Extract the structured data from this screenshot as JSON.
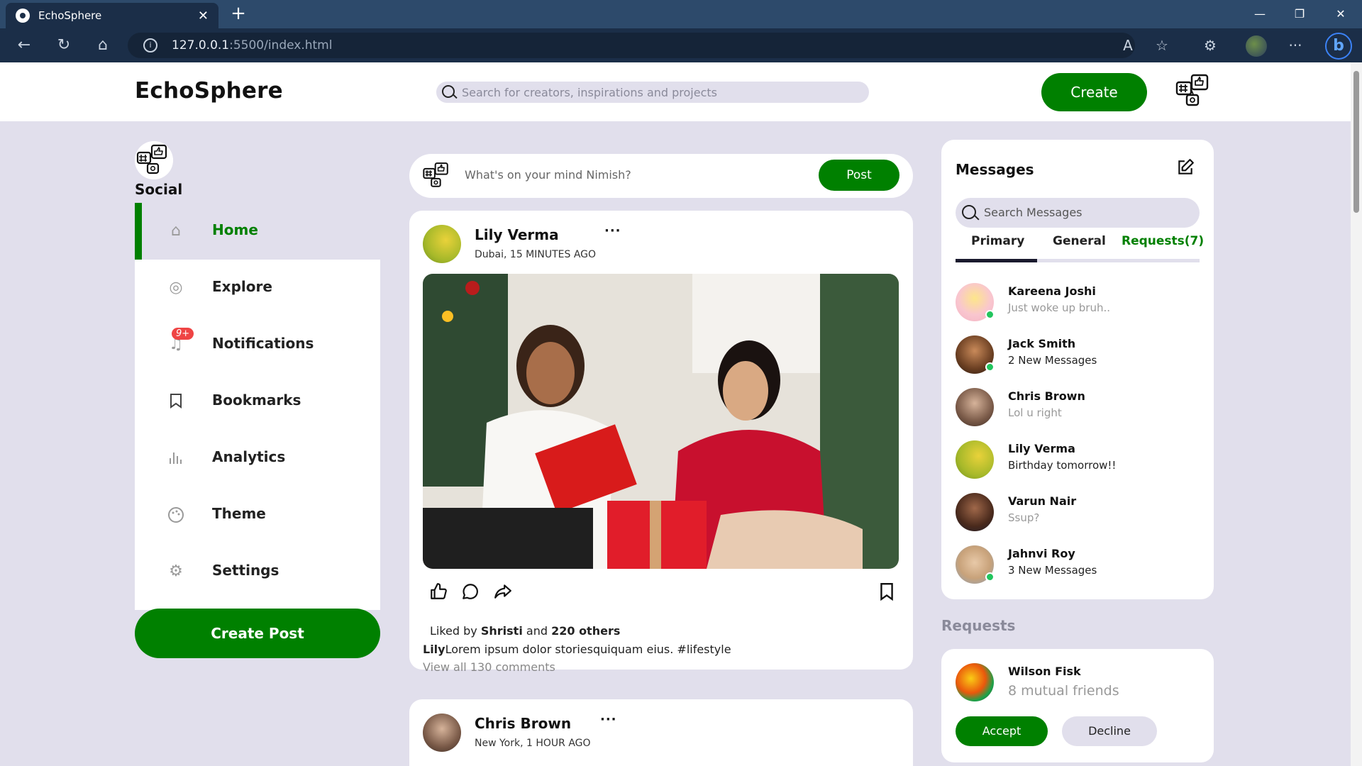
{
  "browser": {
    "tab_title": "EchoSphere",
    "url_host": "127.0.0.1",
    "url_rest": ":5500/index.html"
  },
  "app": {
    "logo": "EchoSphere",
    "search_placeholder": "Search for creators, inspirations and projects",
    "create_label": "Create",
    "accent": "#008000",
    "background": "#e1dfec"
  },
  "sidebar": {
    "profile_label": "Social",
    "items": [
      {
        "label": "Home",
        "icon": "home-icon"
      },
      {
        "label": "Explore",
        "icon": "compass-icon"
      },
      {
        "label": "Notifications",
        "icon": "bell-icon",
        "badge": "9+"
      },
      {
        "label": "Bookmarks",
        "icon": "bookmark-icon"
      },
      {
        "label": "Analytics",
        "icon": "bar-chart-icon"
      },
      {
        "label": "Theme",
        "icon": "palette-icon"
      },
      {
        "label": "Settings",
        "icon": "gear-icon"
      }
    ],
    "create_post_label": "Create Post"
  },
  "composer": {
    "placeholder": "What's on your mind Nimish?",
    "post_label": "Post"
  },
  "feed": [
    {
      "author": "Lily Verma",
      "location": "Dubai, 15 MINUTES AGO",
      "liked_prefix": "Liked by ",
      "liked_user": "Shristi",
      "liked_and": " and ",
      "liked_others": "220 others",
      "caption_user": "Lily",
      "caption_text": "Lorem ipsum dolor storiesquiquam eius. #lifestyle",
      "view_comments": "View all 130 comments"
    },
    {
      "author": "Chris Brown",
      "location": "New York, 1 HOUR AGO"
    }
  ],
  "messages": {
    "title": "Messages",
    "search_placeholder": "Search Messages",
    "tabs": [
      "Primary",
      "General",
      "Requests(7)"
    ],
    "list": [
      {
        "name": "Kareena Joshi",
        "text": "Just woke up bruh..",
        "online": true,
        "unread": false
      },
      {
        "name": "Jack Smith",
        "text": "2 New Messages",
        "online": true,
        "unread": true
      },
      {
        "name": "Chris Brown",
        "text": "Lol u right",
        "online": false,
        "unread": false
      },
      {
        "name": "Lily Verma",
        "text": "Birthday tomorrow!!",
        "online": false,
        "unread": true
      },
      {
        "name": "Varun Nair",
        "text": "Ssup?",
        "online": false,
        "unread": false
      },
      {
        "name": "Jahnvi Roy",
        "text": "3 New Messages",
        "online": true,
        "unread": true
      }
    ]
  },
  "requests": {
    "title": "Requests",
    "name": "Wilson Fisk",
    "mutual": "8 mutual friends",
    "accept_label": "Accept",
    "decline_label": "Decline"
  }
}
